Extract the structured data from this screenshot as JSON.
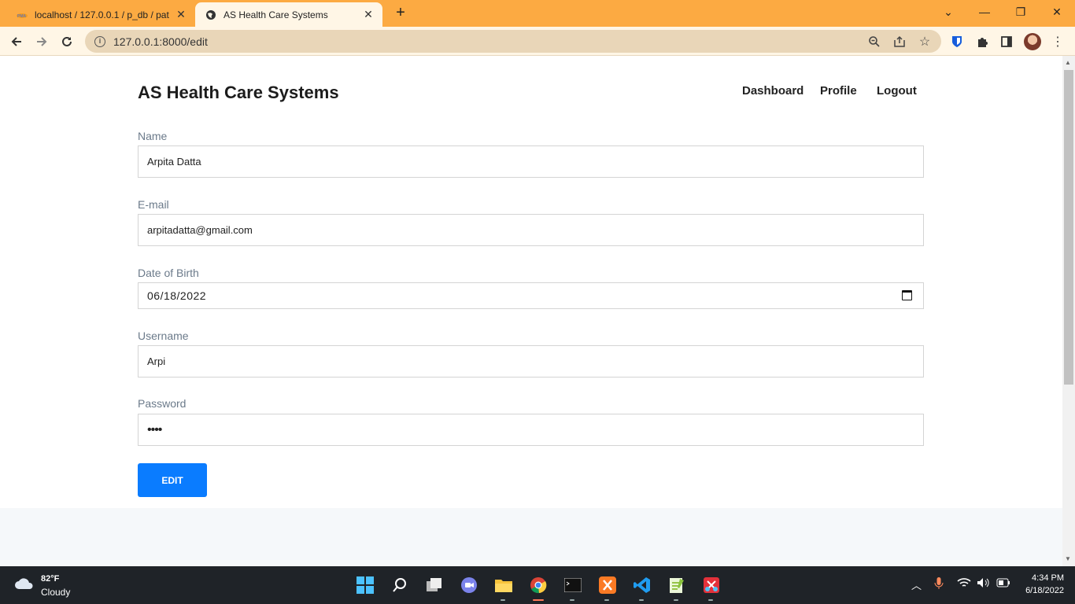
{
  "browser": {
    "tabs": [
      {
        "title": "localhost / 127.0.0.1 / p_db / pat",
        "icon": "phpmyadmin-icon",
        "active": false
      },
      {
        "title": "AS Health Care Systems",
        "icon": "globe-icon",
        "active": true
      }
    ],
    "url": "127.0.0.1:8000/edit"
  },
  "header": {
    "brand": "AS Health Care Systems",
    "nav": [
      "Dashboard",
      "Profile",
      "Logout"
    ]
  },
  "form": {
    "name_label": "Name",
    "name_value": "Arpita Datta",
    "email_label": "E-mail",
    "email_value": "arpitadatta@gmail.com",
    "dob_label": "Date of Birth",
    "dob_value": "06/18/2022",
    "username_label": "Username",
    "username_value": "Arpi",
    "password_label": "Password",
    "password_value": "••••",
    "submit_label": "EDIT"
  },
  "taskbar": {
    "temperature": "82°F",
    "condition": "Cloudy",
    "time": "4:34 PM",
    "date": "6/18/2022"
  },
  "colors": {
    "tabbar": "#fcaa42",
    "toolbar": "#fff6e6",
    "button": "#0a7cff"
  }
}
